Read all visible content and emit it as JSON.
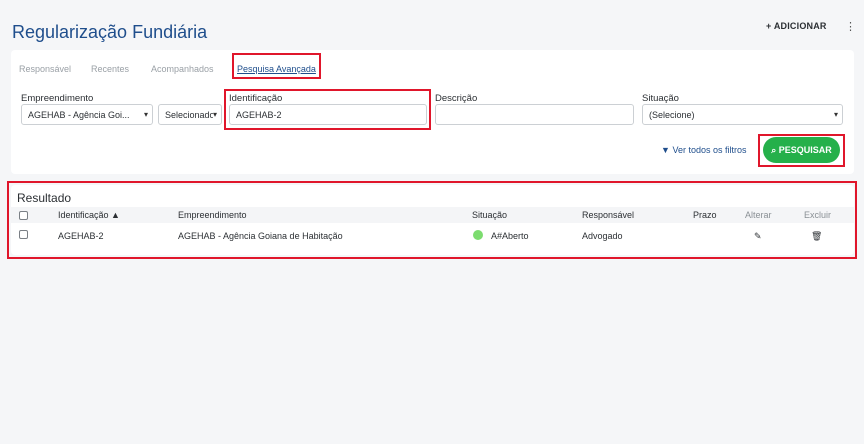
{
  "header": {
    "title": "Regularização Fundiária",
    "add_label": "+ ADICIONAR",
    "menu_glyph": "⋮"
  },
  "tabs": [
    {
      "label": "Responsável"
    },
    {
      "label": "Recentes"
    },
    {
      "label": "Acompanhados"
    },
    {
      "label": "Pesquisa Avançada"
    }
  ],
  "filters": {
    "empreendimento": {
      "label": "Empreendimento",
      "value": "AGEHAB - Agência Goi...",
      "secondary_value": "Selecionado"
    },
    "identificacao": {
      "label": "Identificação",
      "value": "AGEHAB-2"
    },
    "descricao": {
      "label": "Descrição",
      "value": ""
    },
    "situacao": {
      "label": "Situação",
      "value": "(Selecione)"
    },
    "see_all_filters": "Ver todos os filtros",
    "search_button": "PESQUISAR"
  },
  "results": {
    "title": "Resultado",
    "columns": [
      "Identificação ▲",
      "Empreendimento",
      "Situação",
      "Responsável",
      "Prazo",
      "Alterar",
      "Excluir"
    ],
    "rows": [
      {
        "identificacao": "AGEHAB-2",
        "empreendimento": "AGEHAB - Agência Goiana de Habitação",
        "situacao": "A#Aberto",
        "responsavel": "Advogado",
        "prazo": ""
      }
    ]
  },
  "colors": {
    "accent": "#1f4e8c",
    "success": "#25b04a",
    "highlight": "#e0162b",
    "status_dot": "#7cdc6f"
  }
}
